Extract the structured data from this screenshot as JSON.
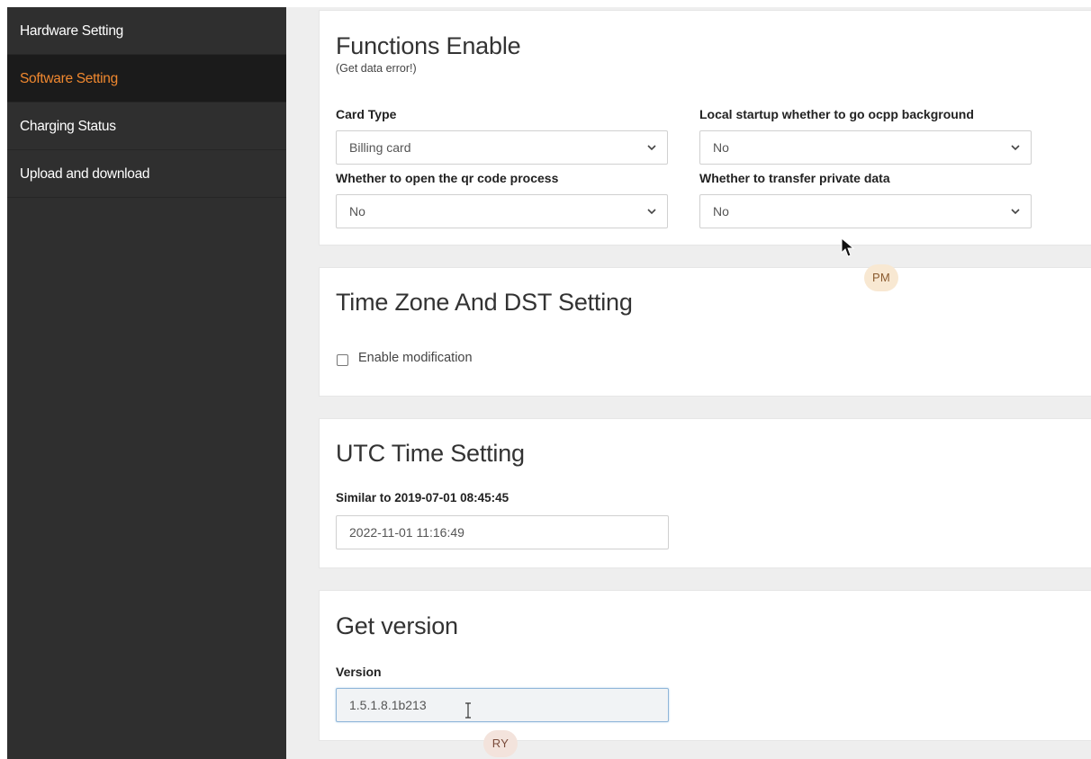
{
  "sidebar": {
    "items": [
      {
        "label": "Hardware Setting"
      },
      {
        "label": "Software Setting"
      },
      {
        "label": "Charging Status"
      },
      {
        "label": "Upload and download"
      }
    ]
  },
  "functions": {
    "title": "Functions Enable",
    "note": "(Get data error!)",
    "card_type": {
      "label": "Card Type",
      "value": "Billing card"
    },
    "local_startup": {
      "label": "Local startup whether to go ocpp background",
      "value": "No"
    },
    "qr_code": {
      "label": "Whether to open the qr code process",
      "value": "No"
    },
    "private_data": {
      "label": "Whether to transfer private data",
      "value": "No"
    }
  },
  "timezone": {
    "title": "Time Zone And DST Setting",
    "checkbox_label": "Enable modification",
    "checked": false
  },
  "utc": {
    "title": "UTC Time Setting",
    "hint": "Similar to 2019-07-01 08:45:45",
    "value": "2022-11-01 11:16:49"
  },
  "version": {
    "title": "Get version",
    "label": "Version",
    "value": "1.5.1.8.1b213"
  },
  "cursors": {
    "pm_badge": "PM",
    "ry_badge": "RY"
  },
  "colors": {
    "sidebar_bg": "#2f2f2f",
    "active_item_bg": "#1b1b1b",
    "active_item_text": "#f0882f",
    "content_bg": "#eeeeee"
  },
  "icons": [
    "chevron-down-icon",
    "mouse-pointer-icon",
    "text-cursor-icon"
  ]
}
